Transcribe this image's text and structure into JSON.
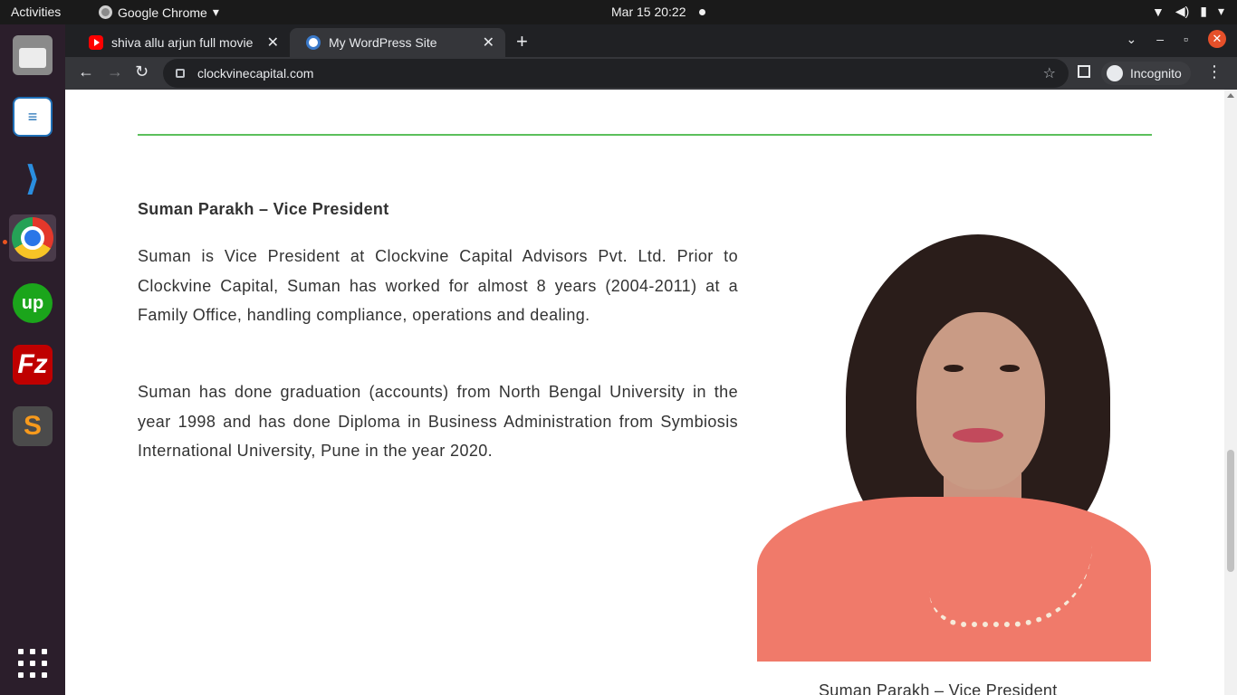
{
  "system_bar": {
    "activities": "Activities",
    "app_name": "Google Chrome",
    "datetime": "Mar 15  20:22"
  },
  "dock": {
    "items": [
      "Files",
      "LibreOffice Writer",
      "Visual Studio Code",
      "Google Chrome",
      "Upwork",
      "FileZilla",
      "Sublime Text"
    ],
    "active": "Google Chrome"
  },
  "browser": {
    "tabs": [
      {
        "title": "shiva allu arjun full movie",
        "favicon": "youtube-icon"
      },
      {
        "title": "My WordPress Site",
        "favicon": "wordpress-icon"
      }
    ],
    "url": "clockvinecapital.com",
    "profile_label": "Incognito"
  },
  "page": {
    "heading": "Suman Parakh – Vice President",
    "paragraphs": [
      "Suman is Vice President at Clockvine Capital Advisors Pvt. Ltd. Prior to Clockvine Capital, Suman has worked for almost 8 years (2004-2011) at a Family Office, handling compliance, operations and dealing.",
      "Suman has done graduation (accounts) from North Bengal University in the year 1998 and has done Diploma in Business Administration from Symbiosis International University, Pune in the year 2020."
    ],
    "photo_caption": "Suman Parakh – Vice President",
    "accent_color": "#5cc05c"
  }
}
